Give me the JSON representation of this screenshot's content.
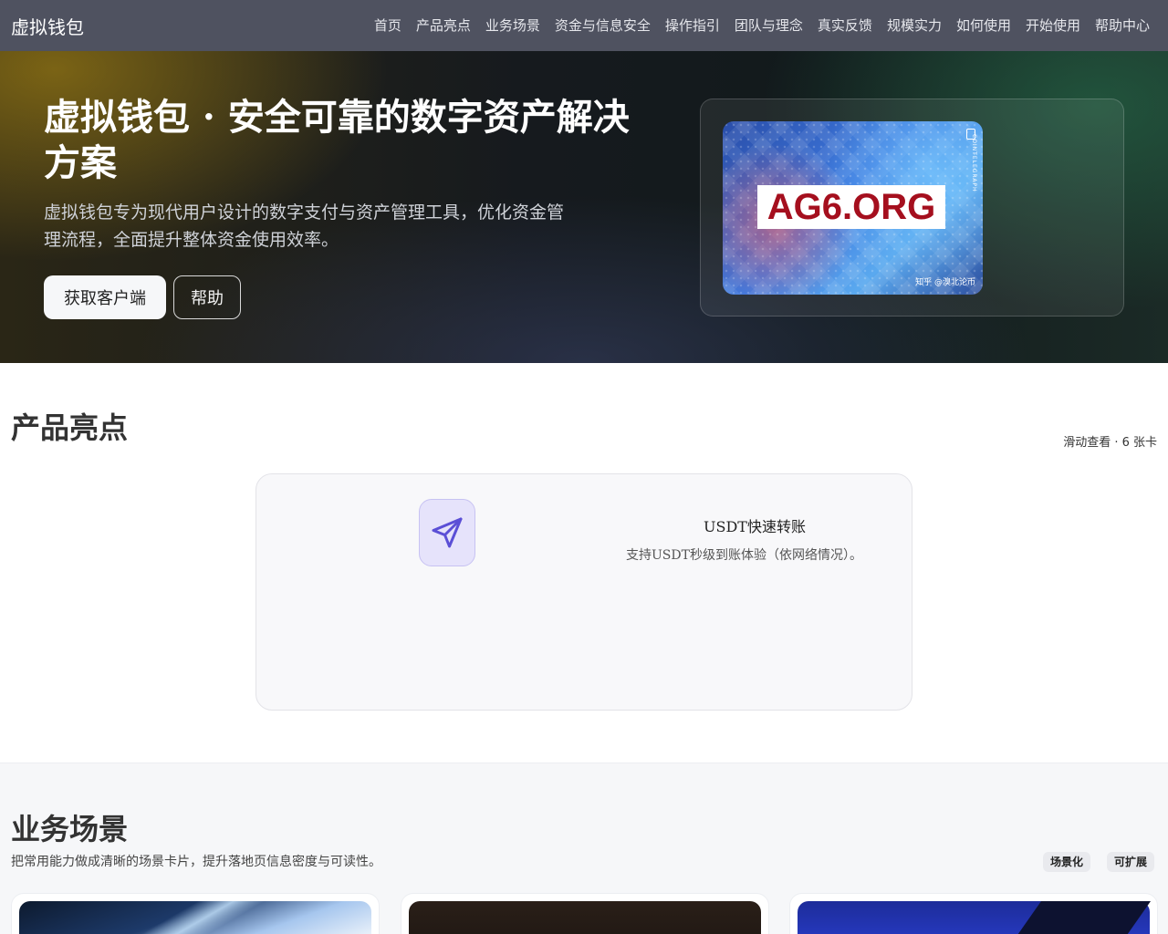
{
  "nav": {
    "brand": "虚拟钱包",
    "links": [
      "首页",
      "产品亮点",
      "业务场景",
      "资金与信息安全",
      "操作指引",
      "团队与理念",
      "真实反馈",
      "规模实力",
      "如何使用",
      "开始使用",
      "帮助中心"
    ]
  },
  "hero": {
    "title": "虚拟钱包 · 安全可靠的数字资产解决方案",
    "description": "虚拟钱包专为现代用户设计的数字支付与资产管理工具，优化资金管理流程，全面提升整体资金使用效率。",
    "primary_button": "获取客户端",
    "secondary_button": "帮助",
    "image": {
      "watermark": "AG6.ORG",
      "caption": "知乎 @溴北论币",
      "side_text": "COINTELEGRAPH"
    }
  },
  "highlights": {
    "title": "产品亮点",
    "meta": "滑动查看 · 6 张卡",
    "card": {
      "icon": "paper-plane-icon",
      "title": "USDT快速转账",
      "description": "支持USDT秒级到账体验（依网络情况）。"
    }
  },
  "scenarios": {
    "title": "业务场景",
    "subtitle": "把常用能力做成清晰的场景卡片，提升落地页信息密度与可读性。",
    "tags": [
      "场景化",
      "可扩展"
    ]
  },
  "colors": {
    "nav_bg": "#4f5260",
    "icon_accent": "#5b4fd6",
    "watermark_red": "#a50f1e"
  }
}
